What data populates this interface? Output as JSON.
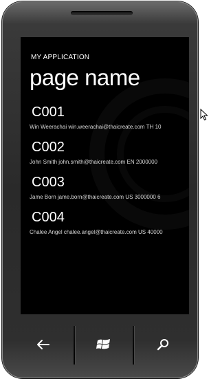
{
  "app": {
    "title": "MY APPLICATION",
    "page_name": "page name"
  },
  "items": [
    {
      "id": "C001",
      "detail": "Win Weerachai win.weerachai@thaicreate.com TH 10"
    },
    {
      "id": "C002",
      "detail": "John  Smith john.smith@thaicreate.com EN 2000000"
    },
    {
      "id": "C003",
      "detail": "Jame Born jame.born@thaicreate.com US 3000000 6"
    },
    {
      "id": "C004",
      "detail": "Chalee Angel chalee.angel@thaicreate.com US 40000"
    }
  ],
  "nav": {
    "back": "back-arrow-icon",
    "start": "windows-logo-icon",
    "search": "search-icon"
  },
  "colors": {
    "screen_bg": "#000000",
    "text_primary": "#ffffff",
    "text_secondary": "#d8d8d8",
    "phone_body": "#2a2a2a"
  }
}
